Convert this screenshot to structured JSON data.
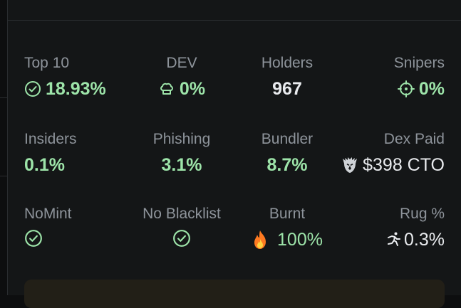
{
  "stats": {
    "top10": {
      "label": "Top 10",
      "value": "18.93%",
      "icon": "check-circle-icon"
    },
    "dev": {
      "label": "DEV",
      "value": "0%",
      "icon": "chef-hat-icon"
    },
    "holders": {
      "label": "Holders",
      "value": "967"
    },
    "snipers": {
      "label": "Snipers",
      "value": "0%",
      "icon": "crosshair-icon"
    },
    "insiders": {
      "label": "Insiders",
      "value": "0.1%"
    },
    "phishing": {
      "label": "Phishing",
      "value": "3.1%"
    },
    "bundler": {
      "label": "Bundler",
      "value": "8.7%"
    },
    "dexpaid": {
      "label": "Dex Paid",
      "value": "$398 CTO",
      "icon": "eagle-icon"
    },
    "nomint": {
      "label": "NoMint",
      "icon": "check-circle-icon"
    },
    "noblacklist": {
      "label": "No Blacklist",
      "icon": "check-circle-icon"
    },
    "burnt": {
      "label": "Burnt",
      "value": "100%",
      "icon": "fire-icon"
    },
    "rug": {
      "label": "Rug %",
      "value": "0.3%",
      "icon": "running-man-icon"
    }
  },
  "colors": {
    "accent_green": "#9de4a9",
    "label_gray": "#8e949b",
    "value_white": "#e9ebee"
  }
}
